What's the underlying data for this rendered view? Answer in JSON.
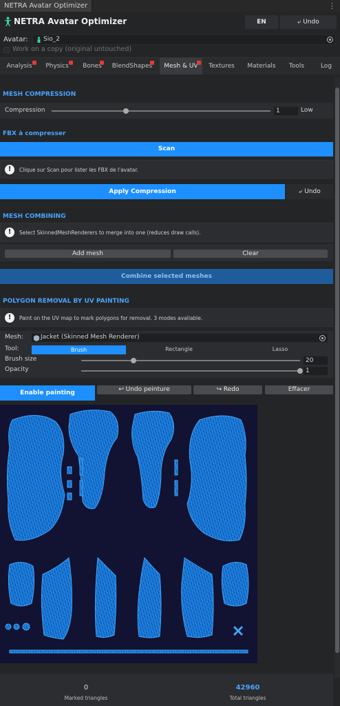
{
  "window": {
    "title": "NETRA Avatar Optimizer"
  },
  "header": {
    "title": "NETRA Avatar Optimizer",
    "lang_button": "EN",
    "undo_label": "Undo",
    "undo_icon": "undo-icon"
  },
  "avatar": {
    "label": "Avatar:",
    "value": "Sio_2",
    "copy_label": "Work on a copy (original untouched)",
    "copy_checked": false
  },
  "tabs": [
    {
      "label": "Analysis",
      "warning": true
    },
    {
      "label": "Physics",
      "warning": true
    },
    {
      "label": "Bones",
      "warning": true
    },
    {
      "label": "BlendShapes",
      "warning": true
    },
    {
      "label": "Mesh & UV",
      "warning": true,
      "active": true
    },
    {
      "label": "Textures",
      "warning": false
    },
    {
      "label": "Materials",
      "warning": false
    },
    {
      "label": "Tools",
      "warning": false
    },
    {
      "label": "Log",
      "warning": false
    }
  ],
  "mesh_compression": {
    "title": "MESH COMPRESSION",
    "label": "Compression",
    "value": "1",
    "slider_fraction": 0.34,
    "level": "Low"
  },
  "fbx": {
    "title": "FBX à compresser",
    "scan_label": "Scan",
    "help": "Clique sur  Scan pour lister les FBX de l'avatar.",
    "apply_label": "Apply Compression",
    "undo_label": "Undo"
  },
  "mesh_combining": {
    "title": "MESH COMBINING",
    "help": "Select SkinnedMeshRenderers to merge into one (reduces draw calls).",
    "add_label": "Add mesh",
    "clear_label": "Clear",
    "combine_label": "Combine selected meshes"
  },
  "polygon_removal": {
    "title": "POLYGON REMOVAL BY UV PAINTING",
    "help": "Paint on the UV map to mark polygons for removal. 3 modes available.",
    "mesh_label": "Mesh:",
    "mesh_value": "Jacket (Skinned Mesh Renderer)",
    "tool_label": "Tool:",
    "tools": [
      "Brush",
      "Rectangle",
      "Lasso"
    ],
    "active_tool": "Brush",
    "brush_size_label": "Brush size",
    "brush_size_value": "20",
    "brush_size_fraction": 0.24,
    "opacity_label": "Opacity",
    "opacity_value": "1",
    "opacity_fraction": 1.0,
    "enable_label": "Enable painting",
    "undo_paint_label": "Undo peinture",
    "redo_label": "Redo",
    "clear_label": "Effacer"
  },
  "stats": {
    "marked_value": "0",
    "marked_label": "Marked triangles",
    "total_value": "42960",
    "total_label": "Total triangles"
  },
  "colors": {
    "accent": "#1e8fff",
    "uv_bg": "#121233",
    "uv_mesh": "#2196f3",
    "warning_dot": "#e53935",
    "section_title": "#4aa3ff"
  }
}
